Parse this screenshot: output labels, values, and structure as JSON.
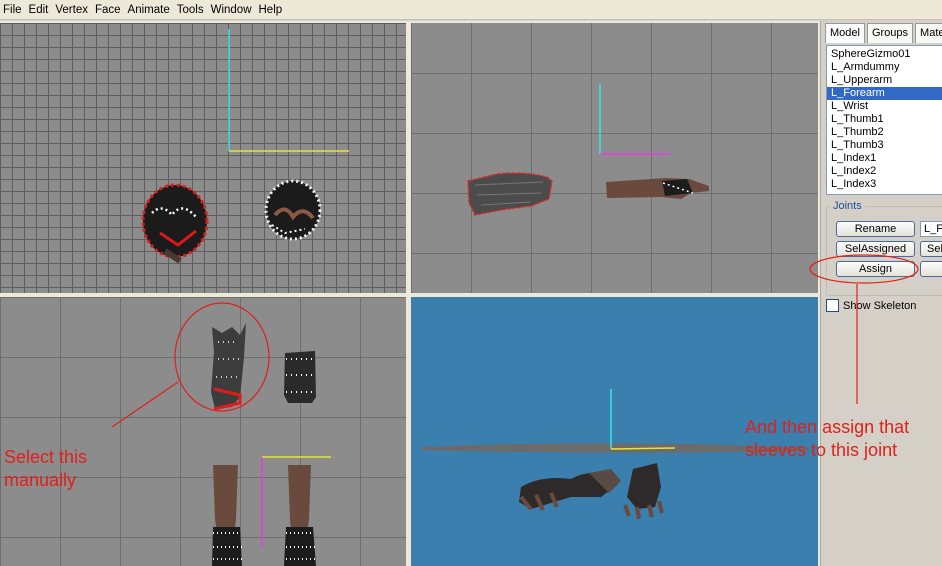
{
  "menu": [
    "File",
    "Edit",
    "Vertex",
    "Face",
    "Animate",
    "Tools",
    "Window",
    "Help"
  ],
  "panel": {
    "tabs": [
      "Model",
      "Groups",
      "Mate"
    ],
    "joints": [
      "SphereGizmo01",
      "L_Armdummy",
      "L_Upperarm",
      "L_Forearm",
      "L_Wrist",
      "L_Thumb1",
      "L_Thumb2",
      "L_Thumb3",
      "L_Index1",
      "L_Index2",
      "L_Index3"
    ],
    "selected_joint": "L_Forearm",
    "joints_group_label": "Joints",
    "rename_label": "Rename",
    "joint_name_value": "L_F",
    "sel_assigned_label": "SelAssigned",
    "sel_partial_label": "Sel",
    "assign_label": "Assign",
    "show_skeleton_label": "Show Skeleton"
  },
  "annotations": {
    "select_manually": "Select this manually",
    "assign_note": "And then assign that sleeves to this joint"
  },
  "colors": {
    "annotation": "#e0201a",
    "selection": "#316ac5",
    "perspective_bg": "#3a7fad",
    "grid_bg": "#8c8c8c"
  }
}
